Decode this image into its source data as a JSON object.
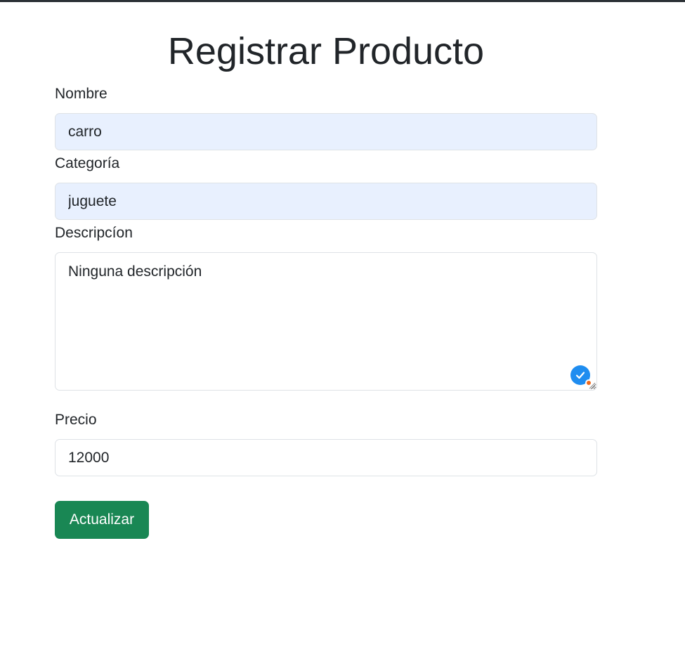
{
  "page": {
    "title": "Registrar Producto"
  },
  "form": {
    "nombre": {
      "label": "Nombre",
      "value": "carro"
    },
    "categoria": {
      "label": "Categoría",
      "value": "juguete"
    },
    "descripcion": {
      "label": "Descripcíon",
      "value": "Ninguna descripción"
    },
    "precio": {
      "label": "Precio",
      "value": "12000"
    },
    "submit_label": "Actualizar"
  },
  "colors": {
    "autofill_bg": "#e8f0fe",
    "button_bg": "#198754",
    "border": "#dee2e6",
    "text": "#212529"
  },
  "icons": {
    "grammar_checker": "checkmark-badge-icon",
    "resize": "resize-grip-icon"
  }
}
